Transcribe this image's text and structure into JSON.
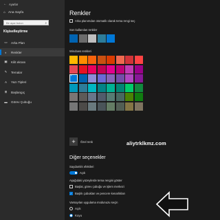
{
  "window": {
    "title": "Ayarlar"
  },
  "sidebar": {
    "home_label": "Ana Sayfa",
    "search_placeholder": "Bir ayar bulun",
    "section_title": "Kişiselleştirme",
    "items": [
      {
        "label": "Arka Plan",
        "icon": "image-icon"
      },
      {
        "label": "Renkler",
        "icon": "palette-icon",
        "active": true
      },
      {
        "label": "Kilit ekranı",
        "icon": "lock-screen-icon"
      },
      {
        "label": "Temalar",
        "icon": "brush-icon"
      },
      {
        "label": "Yazı Tipleri",
        "icon": "font-icon"
      },
      {
        "label": "Başlangıç",
        "icon": "start-icon"
      },
      {
        "label": "Görev Çubuğu",
        "icon": "taskbar-icon"
      }
    ]
  },
  "main": {
    "title": "Renkler",
    "auto_pick_label": "Arka planımdan otomatik olarak tema rengi seç",
    "recent_label": "Son kullanılan renkler",
    "recent_colors": [
      "#0063b1",
      "#6b6b6b",
      "#bfbfbf",
      "#2d7d9a",
      "#0078d7"
    ],
    "windows_colors_label": "Windows renkleri",
    "windows_colors": [
      "#ffb900",
      "#ff8c00",
      "#f7630c",
      "#ca5010",
      "#da3b01",
      "#ef6950",
      "#d13438",
      "#ff4343",
      "#e74856",
      "#e81123",
      "#ea005e",
      "#c30052",
      "#e3008c",
      "#bf0077",
      "#c239b3",
      "#9a0089",
      "#0078d7",
      "#0063b1",
      "#8e8cd8",
      "#6b69d6",
      "#8764b8",
      "#744da9",
      "#b146c2",
      "#881798",
      "#0099bc",
      "#2d7d9a",
      "#00b7c3",
      "#038387",
      "#00b294",
      "#018574",
      "#00cc6a",
      "#10893e",
      "#7a7574",
      "#5d5a58",
      "#68768a",
      "#515c6b",
      "#567c73",
      "#486860",
      "#498205",
      "#107c10",
      "#767676",
      "#4c4a48",
      "#69797e",
      "#4a5459",
      "#647c64",
      "#525e54",
      "#847545",
      "#7e735f"
    ],
    "selected_color_index": 16,
    "custom_color_label": "Özel renk",
    "watermark": "aliytrklkmz.com",
    "more_options_heading": "Diğer seçenekler",
    "transparency_label": "Saydamlık efektleri",
    "transparency_state": "Açık",
    "accent_surfaces_label": "Aşağıdaki yüzeylerde tema rengini göster",
    "start_taskbar_label": "Başlat, görev çubuğu ve işlem merkezi",
    "title_bars_label": "Başlık çubukları ve pencere kenarlıkları",
    "app_mode_label": "Varsayılan uygulama modunuzu seçin",
    "mode_light": "Açık",
    "mode_dark": "Koyu",
    "selected_mode": "Koyu"
  }
}
